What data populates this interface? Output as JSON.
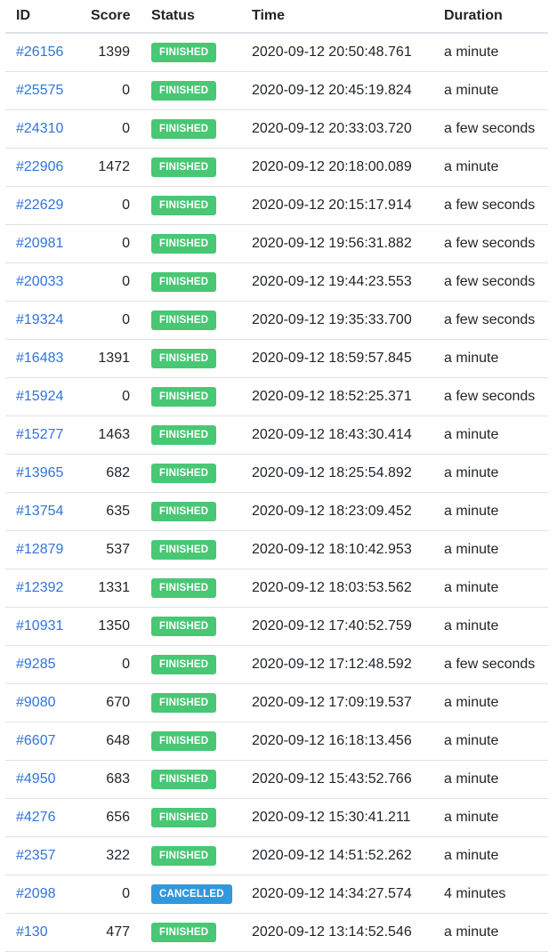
{
  "table": {
    "headers": {
      "id": "ID",
      "score": "Score",
      "status": "Status",
      "time": "Time",
      "duration": "Duration"
    },
    "status_colors": {
      "FINISHED": "#48c774",
      "CANCELLED": "#3298dc"
    },
    "link_color": "#3273dc",
    "rows": [
      {
        "id": "#26156",
        "score": "1399",
        "status": "FINISHED",
        "time": "2020-09-12 20:50:48.761",
        "duration": "a minute"
      },
      {
        "id": "#25575",
        "score": "0",
        "status": "FINISHED",
        "time": "2020-09-12 20:45:19.824",
        "duration": "a minute"
      },
      {
        "id": "#24310",
        "score": "0",
        "status": "FINISHED",
        "time": "2020-09-12 20:33:03.720",
        "duration": "a few seconds"
      },
      {
        "id": "#22906",
        "score": "1472",
        "status": "FINISHED",
        "time": "2020-09-12 20:18:00.089",
        "duration": "a minute"
      },
      {
        "id": "#22629",
        "score": "0",
        "status": "FINISHED",
        "time": "2020-09-12 20:15:17.914",
        "duration": "a few seconds"
      },
      {
        "id": "#20981",
        "score": "0",
        "status": "FINISHED",
        "time": "2020-09-12 19:56:31.882",
        "duration": "a few seconds"
      },
      {
        "id": "#20033",
        "score": "0",
        "status": "FINISHED",
        "time": "2020-09-12 19:44:23.553",
        "duration": "a few seconds"
      },
      {
        "id": "#19324",
        "score": "0",
        "status": "FINISHED",
        "time": "2020-09-12 19:35:33.700",
        "duration": "a few seconds"
      },
      {
        "id": "#16483",
        "score": "1391",
        "status": "FINISHED",
        "time": "2020-09-12 18:59:57.845",
        "duration": "a minute"
      },
      {
        "id": "#15924",
        "score": "0",
        "status": "FINISHED",
        "time": "2020-09-12 18:52:25.371",
        "duration": "a few seconds"
      },
      {
        "id": "#15277",
        "score": "1463",
        "status": "FINISHED",
        "time": "2020-09-12 18:43:30.414",
        "duration": "a minute"
      },
      {
        "id": "#13965",
        "score": "682",
        "status": "FINISHED",
        "time": "2020-09-12 18:25:54.892",
        "duration": "a minute"
      },
      {
        "id": "#13754",
        "score": "635",
        "status": "FINISHED",
        "time": "2020-09-12 18:23:09.452",
        "duration": "a minute"
      },
      {
        "id": "#12879",
        "score": "537",
        "status": "FINISHED",
        "time": "2020-09-12 18:10:42.953",
        "duration": "a minute"
      },
      {
        "id": "#12392",
        "score": "1331",
        "status": "FINISHED",
        "time": "2020-09-12 18:03:53.562",
        "duration": "a minute"
      },
      {
        "id": "#10931",
        "score": "1350",
        "status": "FINISHED",
        "time": "2020-09-12 17:40:52.759",
        "duration": "a minute"
      },
      {
        "id": "#9285",
        "score": "0",
        "status": "FINISHED",
        "time": "2020-09-12 17:12:48.592",
        "duration": "a few seconds"
      },
      {
        "id": "#9080",
        "score": "670",
        "status": "FINISHED",
        "time": "2020-09-12 17:09:19.537",
        "duration": "a minute"
      },
      {
        "id": "#6607",
        "score": "648",
        "status": "FINISHED",
        "time": "2020-09-12 16:18:13.456",
        "duration": "a minute"
      },
      {
        "id": "#4950",
        "score": "683",
        "status": "FINISHED",
        "time": "2020-09-12 15:43:52.766",
        "duration": "a minute"
      },
      {
        "id": "#4276",
        "score": "656",
        "status": "FINISHED",
        "time": "2020-09-12 15:30:41.211",
        "duration": "a minute"
      },
      {
        "id": "#2357",
        "score": "322",
        "status": "FINISHED",
        "time": "2020-09-12 14:51:52.262",
        "duration": "a minute"
      },
      {
        "id": "#2098",
        "score": "0",
        "status": "CANCELLED",
        "time": "2020-09-12 14:34:27.574",
        "duration": "4 minutes"
      },
      {
        "id": "#130",
        "score": "477",
        "status": "FINISHED",
        "time": "2020-09-12 13:14:52.546",
        "duration": "a minute"
      }
    ]
  }
}
